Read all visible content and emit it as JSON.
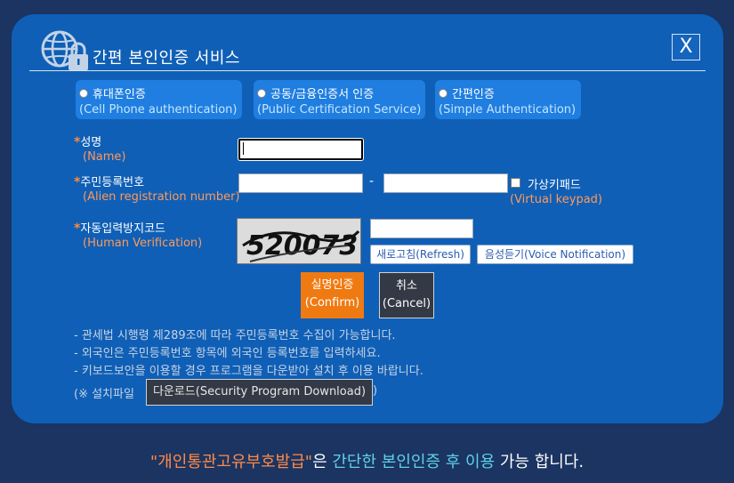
{
  "header": {
    "title": "간편 본인인증 서비스",
    "close_label": "X"
  },
  "tabs": [
    {
      "label": "휴대폰인증",
      "sublabel": "(Cell Phone authentication)"
    },
    {
      "label": "공동/금융인증서 인증",
      "sublabel": "(Public Certification Service)"
    },
    {
      "label": "간편인증",
      "sublabel": "(Simple Authentication)"
    }
  ],
  "form": {
    "required_mark": "*",
    "name_label": "성명",
    "name_sub": "(Name)",
    "reg_label": "주민등록번호",
    "reg_sub": "(Alien registration number)",
    "reg_separator": "-",
    "keypad_label": "가상키패드",
    "keypad_sub": "(Virtual keypad)",
    "captcha_label": "자동입력방지코드",
    "captcha_sub": "(Human Verification)",
    "captcha_code": "520073",
    "refresh_label": "새로고침(Refresh)",
    "voice_label": "음성듣기(Voice Notification)"
  },
  "buttons": {
    "confirm_line1": "실명인증",
    "confirm_line2": "(Confirm)",
    "cancel_line1": "취소",
    "cancel_line2": "(Cancel)"
  },
  "notes": [
    "- 관세법 시행령 제289조에 따라 주민등록번호 수집이 가능합니다.",
    "- 외국인은 주민등록번호 항목에 외국인 등록번호를 입력하세요.",
    "- 키보드보안을 이용할 경우 프로그램을 다운받아 설치 후 이용 바랍니다."
  ],
  "install": {
    "prefix": "(※ 설치파일",
    "download_label": "다운로드(Security Program Download)",
    "suffix": ")"
  },
  "footer": {
    "part1": "\"개인통관고유부호발급\"",
    "part2": "은 ",
    "part3": "간단한 본인인증 후 이용",
    "part4": " 가능 합니다."
  },
  "colors": {
    "modal": "#0f5fb6",
    "tab": "#1f7ee0",
    "accent_orange": "#f07a12",
    "page_bg": "#1b3461"
  },
  "icons": {
    "header": "globe-lock-icon"
  }
}
